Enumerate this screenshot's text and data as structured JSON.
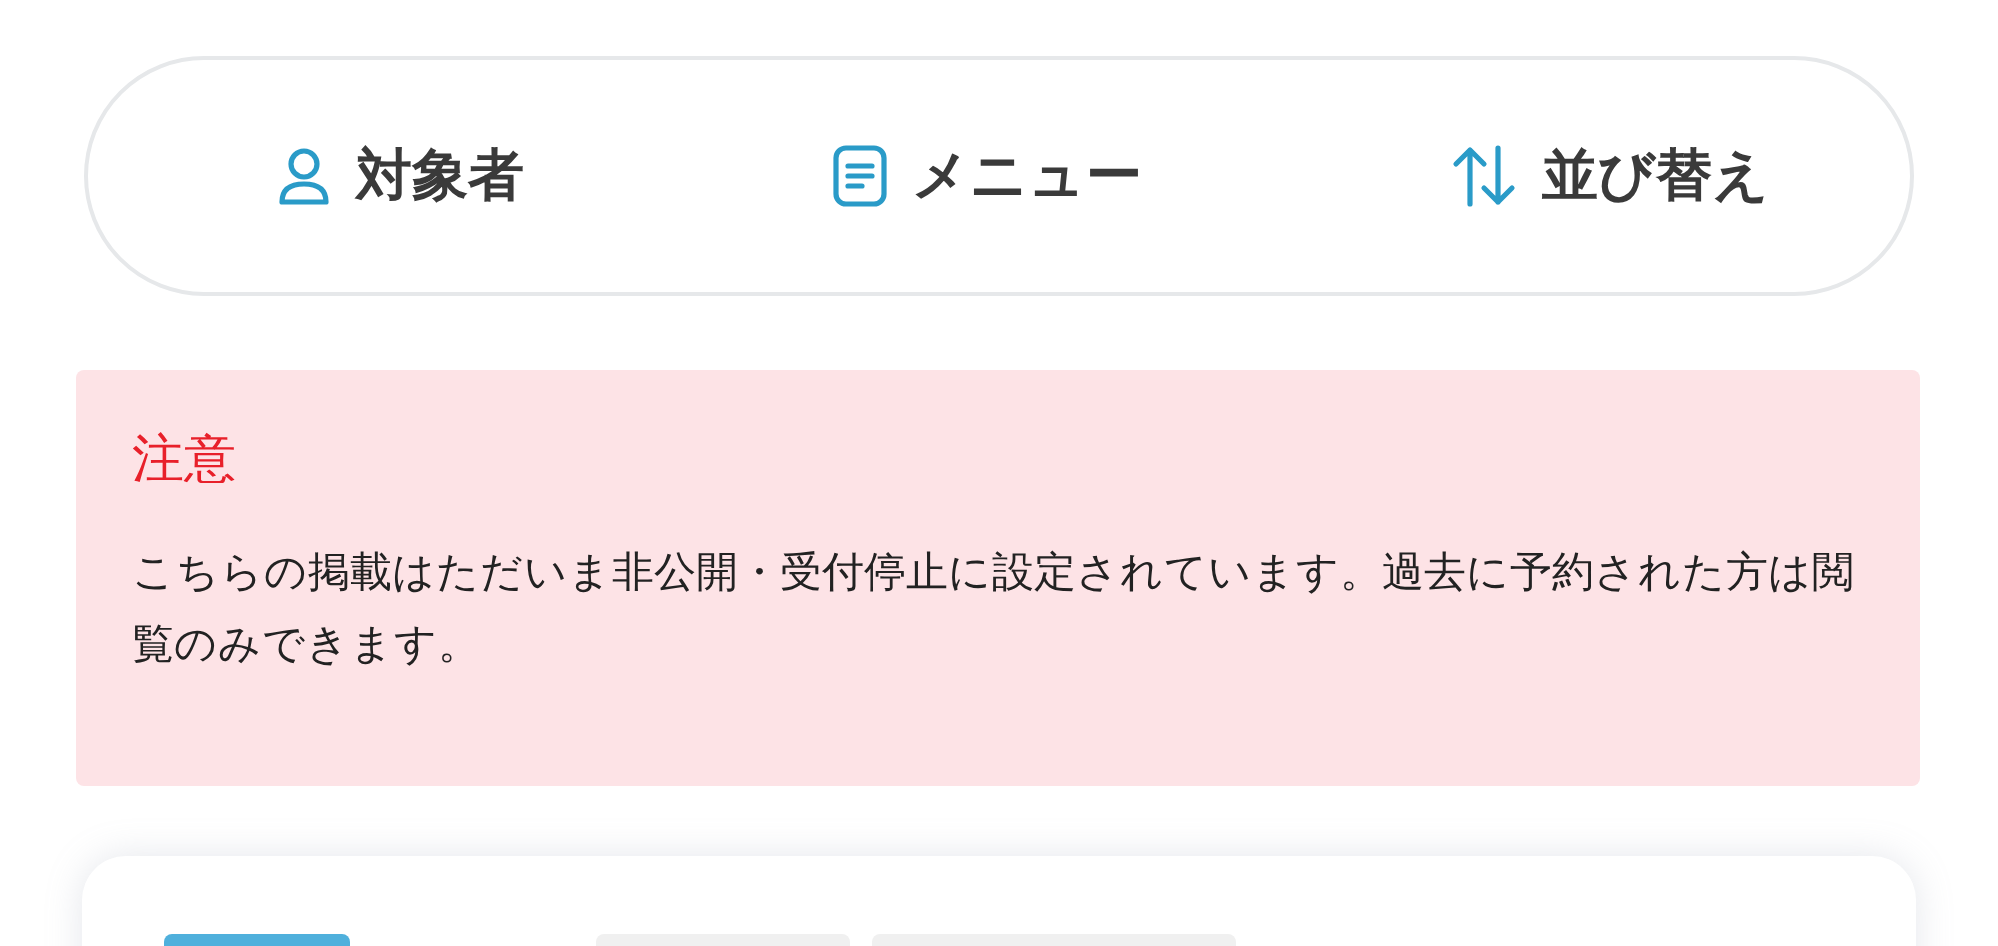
{
  "nav": [
    {
      "kind": "person",
      "label": "対象者"
    },
    {
      "kind": "menu",
      "label": "メニュー"
    },
    {
      "kind": "sort",
      "label": "並び替え"
    }
  ],
  "notice": {
    "title": "注意",
    "text": "こちらの掲載はただいま非公開・受付停止に設定されています。過去に予約された方は閲覧のみできます。"
  }
}
